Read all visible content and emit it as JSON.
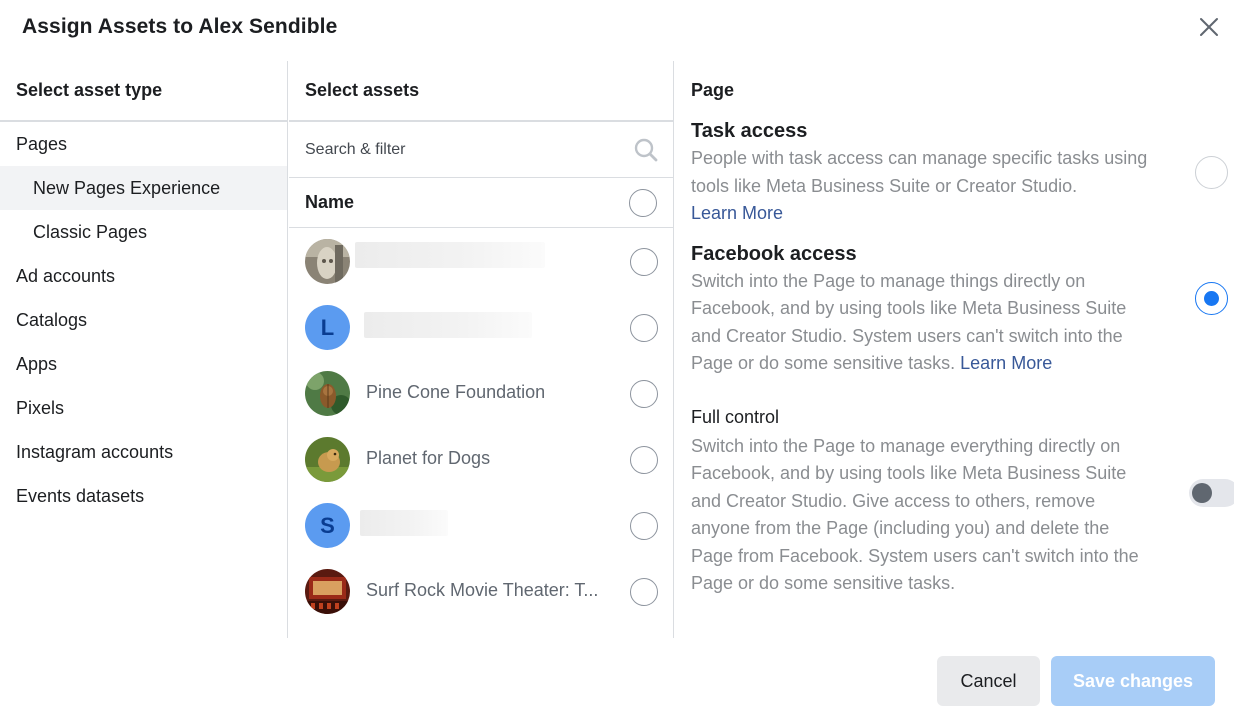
{
  "dialog": {
    "title": "Assign Assets to Alex Sendible",
    "close_icon": "close-icon"
  },
  "asset_types": {
    "heading": "Select asset type",
    "items": [
      {
        "label": "Pages"
      },
      {
        "label": "New Pages Experience"
      },
      {
        "label": "Classic Pages"
      },
      {
        "label": "Ad accounts"
      },
      {
        "label": "Catalogs"
      },
      {
        "label": "Apps"
      },
      {
        "label": "Pixels"
      },
      {
        "label": "Instagram accounts"
      },
      {
        "label": "Events datasets"
      }
    ],
    "selected": "New Pages Experience"
  },
  "assets": {
    "heading": "Select assets",
    "search_placeholder": "Search & filter",
    "name_header": "Name",
    "rows": [
      {
        "name": "",
        "avatar": "photo",
        "letter": ""
      },
      {
        "name": "",
        "avatar": "letter",
        "letter": "L"
      },
      {
        "name": "Pine Cone Foundation",
        "avatar": "photo",
        "letter": ""
      },
      {
        "name": "Planet for Dogs",
        "avatar": "photo",
        "letter": ""
      },
      {
        "name": "",
        "avatar": "letter",
        "letter": "S"
      },
      {
        "name": "Surf Rock Movie Theater: T...",
        "avatar": "photo",
        "letter": ""
      }
    ]
  },
  "permissions": {
    "heading": "Page",
    "task_access": {
      "title": "Task access",
      "description": "People with task access can manage specific tasks using tools like Meta Business Suite or Creator Studio.",
      "link": "Learn More",
      "selected": false
    },
    "facebook_access": {
      "title": "Facebook access",
      "description": "Switch into the Page to manage things directly on Facebook, and by using tools like Meta Business Suite and Creator Studio. System users can't switch into the Page or do some sensitive tasks.",
      "link": "Learn More",
      "selected": true
    },
    "full_control": {
      "title": "Full control",
      "description": "Switch into the Page to manage everything directly on Facebook, and by using tools like Meta Business Suite and Creator Studio. Give access to others, remove anyone from the Page (including you) and delete the Page from Facebook. System users can't switch into the Page or do some sensitive tasks.",
      "enabled": false
    }
  },
  "footer": {
    "cancel_label": "Cancel",
    "save_label": "Save changes"
  },
  "colors": {
    "accent": "#1877f2",
    "save_disabled": "#a8cdf7",
    "link": "#385898",
    "letter_avatar": "#5b9bf0"
  }
}
